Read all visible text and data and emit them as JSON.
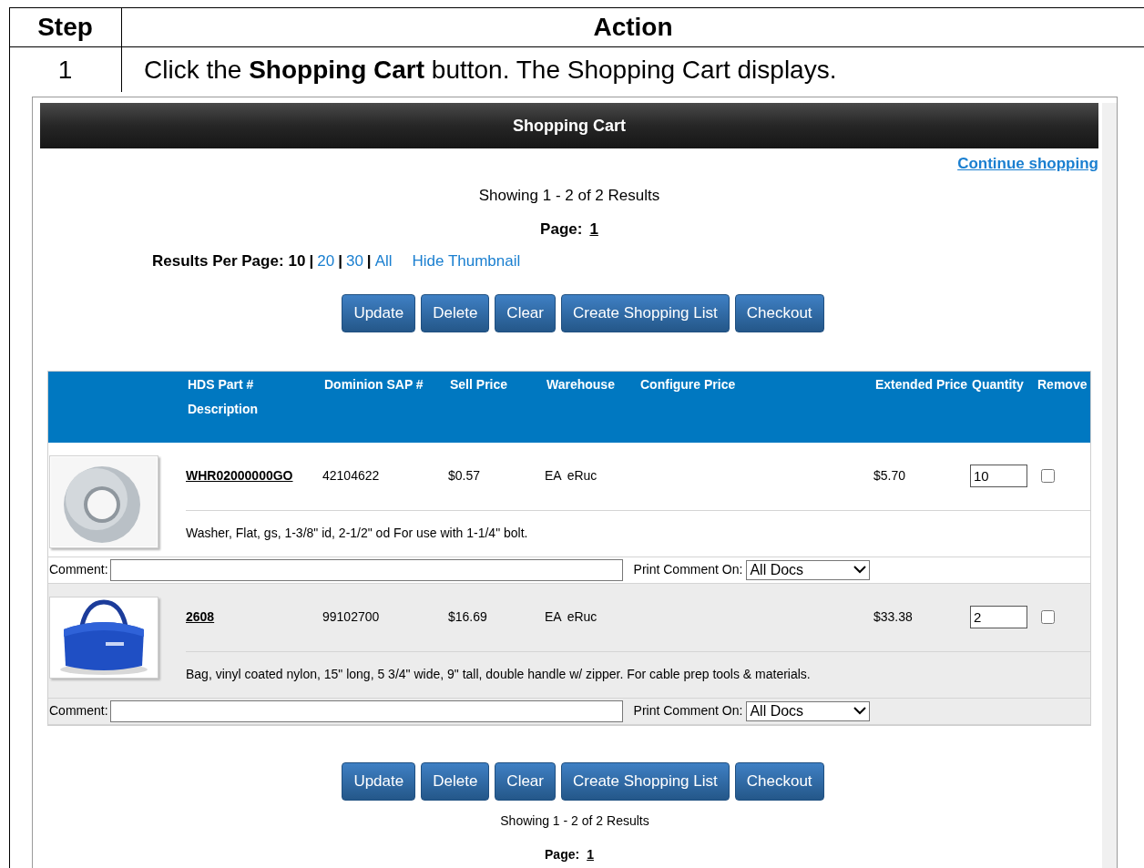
{
  "doc": {
    "columns": [
      "Step",
      "Action"
    ],
    "step": "1",
    "instruction": "Click the **Shopping Cart** button. The Shopping Cart displays."
  },
  "cart": {
    "title": "Shopping Cart",
    "continue_link": "Continue shopping",
    "showing": "Showing 1 - 2 of 2 Results",
    "page_label": "Page:",
    "page_number": "1",
    "results_per_page": {
      "label": "Results Per Page:",
      "separator": "|",
      "options": [
        {
          "label": "10",
          "selected": true
        },
        {
          "label": "20",
          "selected": false
        },
        {
          "label": "30",
          "selected": false
        },
        {
          "label": "All",
          "selected": false
        }
      ]
    },
    "hide_thumbnail": "Hide Thumbnail",
    "buttons": [
      "Update",
      "Delete",
      "Clear",
      "Create Shopping List",
      "Checkout"
    ],
    "columns": [
      "HDS Part #",
      "Dominion SAP #",
      "Sell Price",
      "Warehouse",
      "Configure Price",
      "Extended Price",
      "Quantity",
      "Remove"
    ],
    "description_header": "Description",
    "items": [
      {
        "part": "WHR02000000GO",
        "sap": "42104622",
        "price": "$0.57",
        "uom": "EA",
        "warehouse": "eRuc",
        "extended": "$5.70",
        "quantity": "10",
        "remove": false,
        "description": "Washer, Flat, gs, 1-3/8\" id, 2-1/2\" od For use with 1-1/4\" bolt.",
        "comment_label": "Comment:",
        "print_label": "Print Comment On:",
        "print_value": "All Docs"
      },
      {
        "part": "2608",
        "sap": "99102700",
        "price": "$16.69",
        "uom": "EA",
        "warehouse": "eRuc",
        "extended": "$33.38",
        "quantity": "2",
        "remove": false,
        "description": "Bag, vinyl coated nylon, 15\" long, 5 3/4\" wide, 9\" tall, double handle w/ zipper. For cable prep tools & materials.",
        "comment_label": "Comment:",
        "print_label": "Print Comment On:",
        "print_value": "All Docs"
      }
    ],
    "bottom_buttons": [
      "Update",
      "Delete",
      "Clear",
      "Create Shopping List",
      "Checkout"
    ],
    "bottom_showing": "Showing 1 - 2 of 2 Results",
    "bottom_page_label": "Page:",
    "bottom_page_number": "1"
  }
}
